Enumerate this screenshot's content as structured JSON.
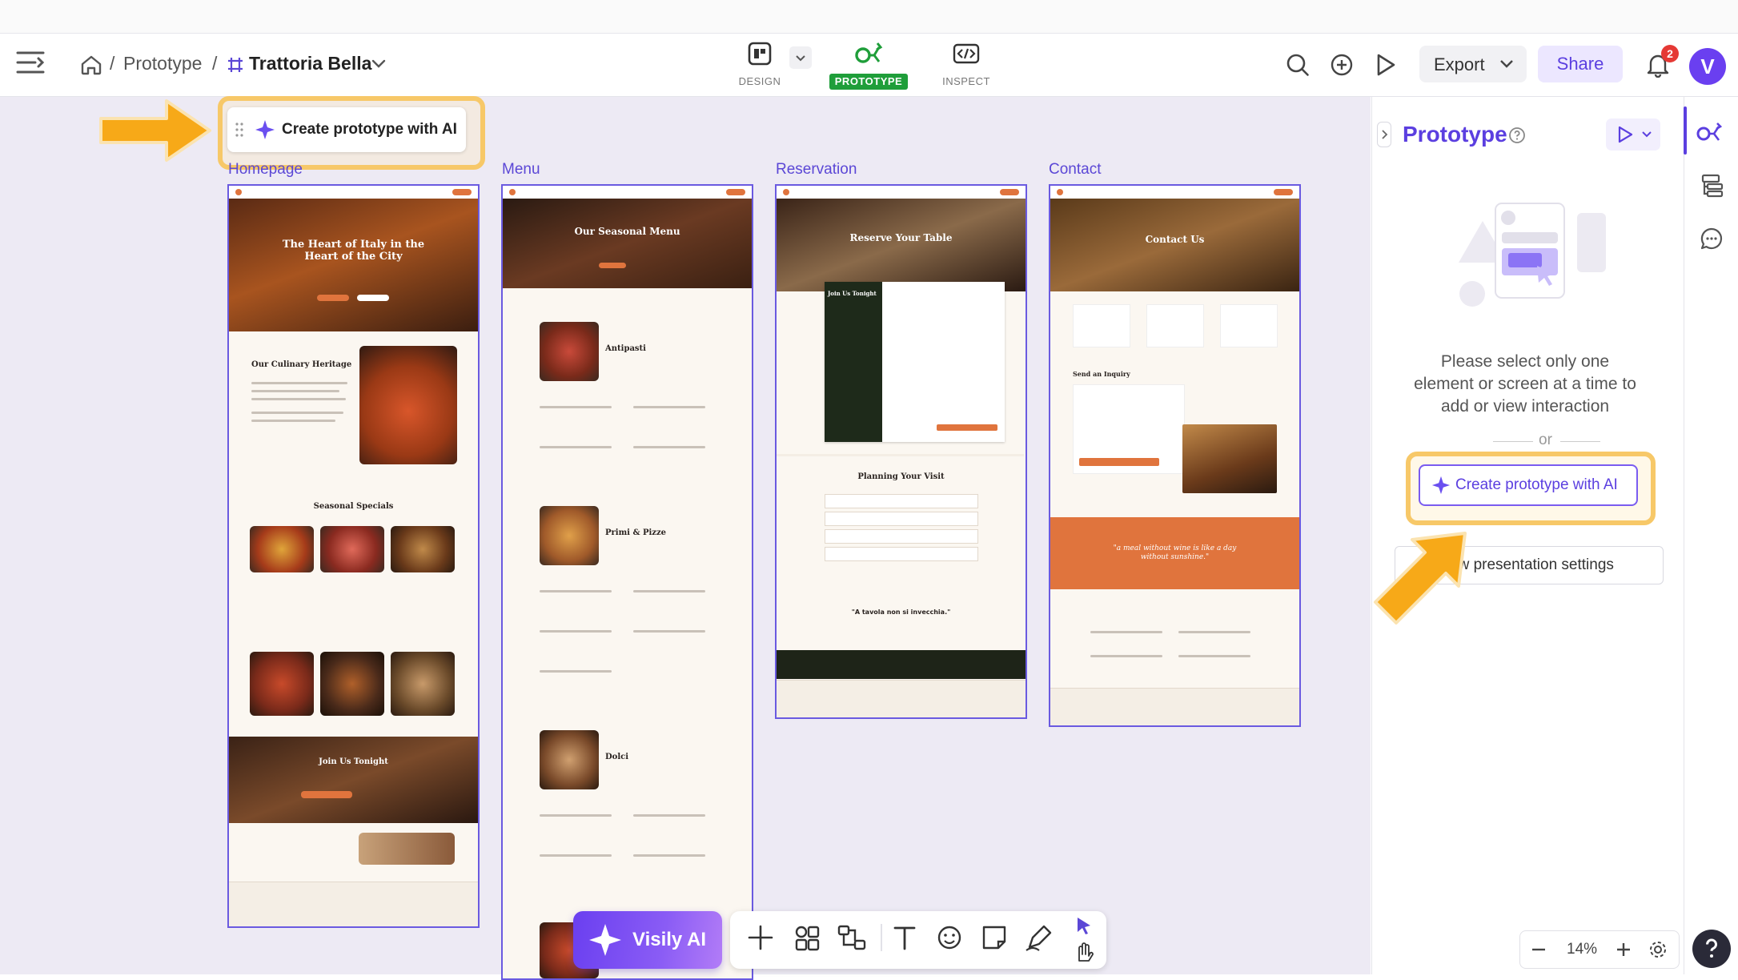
{
  "breadcrumb": {
    "parent": "Prototype",
    "separator": "/",
    "project": "Trattoria Bella"
  },
  "modes": [
    {
      "label": "DESIGN",
      "active": false
    },
    {
      "label": "PROTOTYPE",
      "active": true
    },
    {
      "label": "INSPECT",
      "active": false
    }
  ],
  "header_actions": {
    "export_label": "Export",
    "share_label": "Share",
    "notification_count": "2",
    "avatar_letter": "V"
  },
  "canvas": {
    "create_ai_label": "Create prototype with AI",
    "frames": [
      {
        "label": "Homepage",
        "hero_title": "The Heart of Italy in the Heart of the City",
        "heritage_title": "Our Culinary Heritage",
        "specials_title": "Seasonal Specials",
        "join_title": "Join Us Tonight"
      },
      {
        "label": "Menu",
        "hero_title": "Our Seasonal Menu",
        "sections": [
          "Antipasti",
          "Primi & Pizze",
          "Dolci"
        ]
      },
      {
        "label": "Reservation",
        "hero_title": "Reserve Your Table",
        "side_title": "Join Us Tonight",
        "planning_title": "Planning Your Visit",
        "quote": "\"A tavola non si invecchia.\""
      },
      {
        "label": "Contact",
        "hero_title": "Contact Us",
        "inquiry_title": "Send an Inquiry",
        "quote": "\"a meal without wine is like a day without sunshine.\""
      }
    ]
  },
  "bottom_toolbar": {
    "ai_label": "Visily AI"
  },
  "zoom": {
    "value": "14%"
  },
  "panel": {
    "title": "Prototype",
    "message": "Please select only one element or screen at a time to add or view interaction",
    "or_label": "or",
    "create_ai_label": "Create prototype with AI",
    "settings_label": "ow presentation settings"
  },
  "colors": {
    "accent": "#6a4ff0",
    "prototype_green": "#1f9e3a",
    "highlight": "#f7b733",
    "brand_orange": "#e0743d"
  },
  "icons": [
    "menu-icon",
    "home-icon",
    "frame-icon",
    "chevron-down-icon",
    "search-icon",
    "plus-circle-icon",
    "play-icon",
    "bell-icon",
    "help-circle-icon",
    "sparkle-icon",
    "layers-icon",
    "comment-icon",
    "zoom-in-icon",
    "zoom-out-icon",
    "settings-icon",
    "question-icon"
  ]
}
